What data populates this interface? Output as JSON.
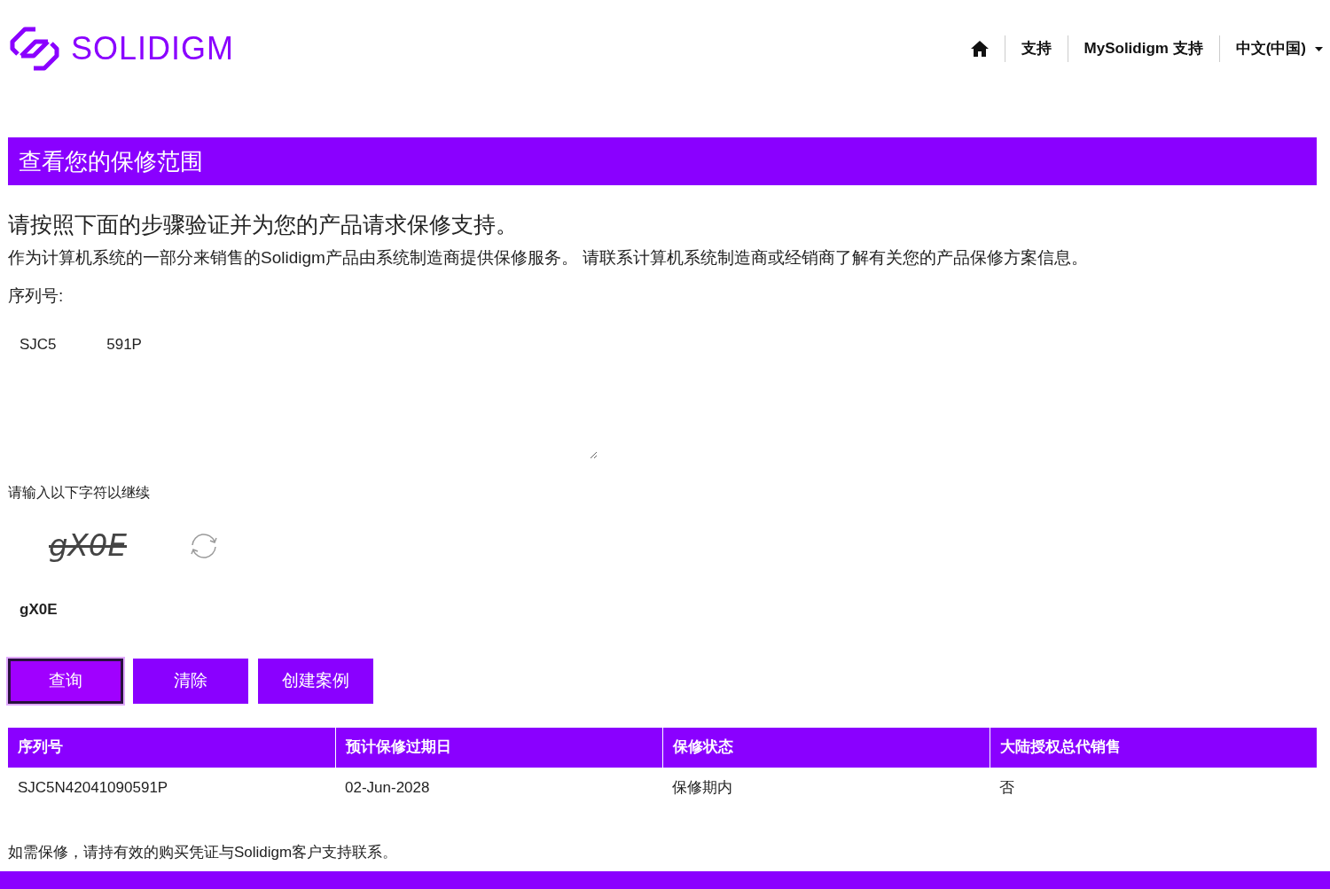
{
  "header": {
    "logo_text": "SOLIDIGM",
    "nav": [
      {
        "kind": "icon"
      },
      {
        "kind": "link",
        "label": "支持"
      },
      {
        "kind": "link",
        "label": "MySolidigm 支持"
      },
      {
        "kind": "dropdown",
        "label": "中文(中国)"
      }
    ]
  },
  "banner": {
    "title": "查看您的保修范围"
  },
  "intro": {
    "heading": "请按照下面的步骤验证并为您的产品请求保修支持。",
    "note": "作为计算机系统的一部分来销售的Solidigm产品由系统制造商提供保修服务。 请联系计算机系统制造商或经销商了解有关您的产品保修方案信息。"
  },
  "serial": {
    "label": "序列号:",
    "value": "SJC5            591P"
  },
  "captcha": {
    "label": "请输入以下字符以继续",
    "image_text": "gX0E",
    "value": "gX0E"
  },
  "buttons": [
    {
      "label": "查询",
      "selected": true
    },
    {
      "label": "清除",
      "selected": false
    },
    {
      "label": "创建案例",
      "selected": false
    }
  ],
  "table": {
    "columns": [
      "序列号",
      "预计保修过期日",
      "保修状态",
      "大陆授权总代销售"
    ],
    "rows": [
      [
        "SJC5N42041090591P",
        "02-Jun-2028",
        "保修期内",
        "否"
      ]
    ]
  },
  "footer_note": "如需保修，请持有效的购买凭证与Solidigm客户支持联系。"
}
